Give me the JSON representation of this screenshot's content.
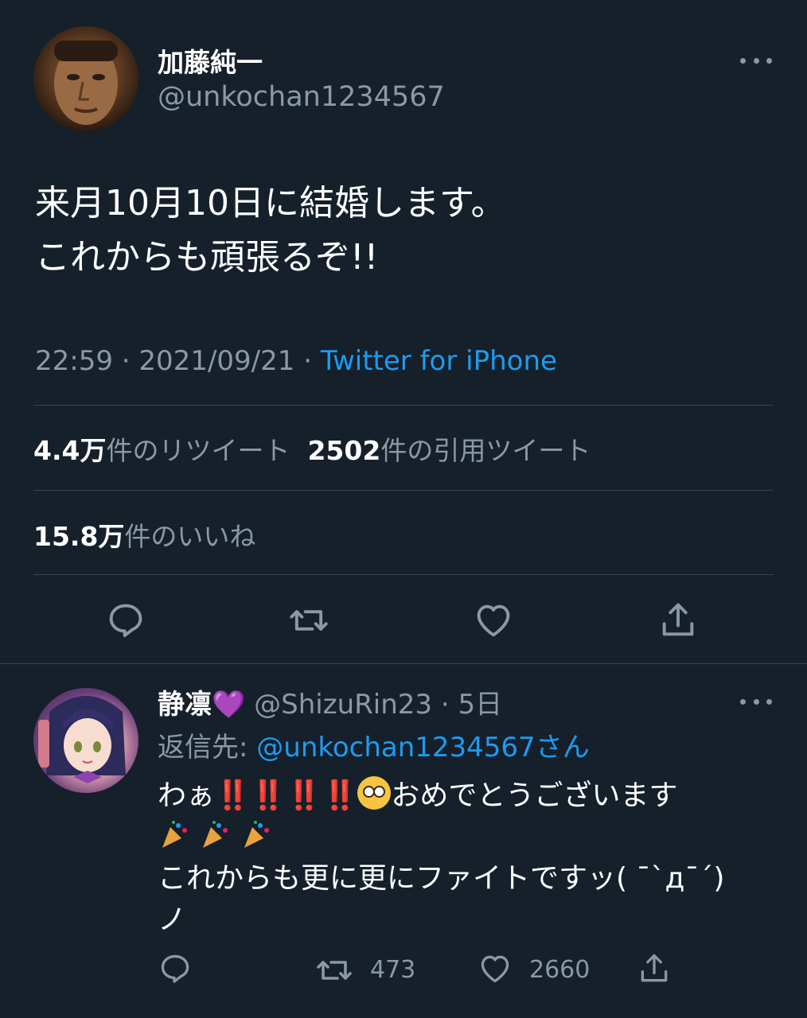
{
  "main_tweet": {
    "display_name": "加藤純一",
    "handle": "@unkochan1234567",
    "text_line1": "来月10月10日に結婚します。",
    "text_line2": "これからも頑張るぞ!!",
    "time": "22:59",
    "date": "2021/09/21",
    "separator": " · ",
    "source": "Twitter for iPhone",
    "retweets_count": "4.4万",
    "retweets_label": "件のリツイート",
    "quotes_count": "2502",
    "quotes_label": "件の引用ツイート",
    "likes_count": "15.8万",
    "likes_label": "件のいいね"
  },
  "reply": {
    "display_name": "静凛",
    "name_emoji": "💜",
    "handle": "@ShizuRin23",
    "age": "5日",
    "replying_label": "返信先: ",
    "replying_to": "@unkochan1234567さん",
    "text_start": "わぁ",
    "bangs": "‼️‼️‼️‼️",
    "text_mid": "おめでとうございます",
    "text_line3": "これからも更に更にファイトですッ( ¯`д¯´)",
    "text_line4": "ノ",
    "retweet_count": "473",
    "like_count": "2660"
  },
  "icons": {
    "reply": "reply-icon",
    "retweet": "retweet-icon",
    "like": "heart-icon",
    "share": "share-icon",
    "more": "more-icon"
  },
  "colors": {
    "background": "#15202b",
    "text": "#ffffff",
    "muted": "#8b98a5",
    "accent": "#1d9bf0",
    "divider": "#38444d"
  }
}
